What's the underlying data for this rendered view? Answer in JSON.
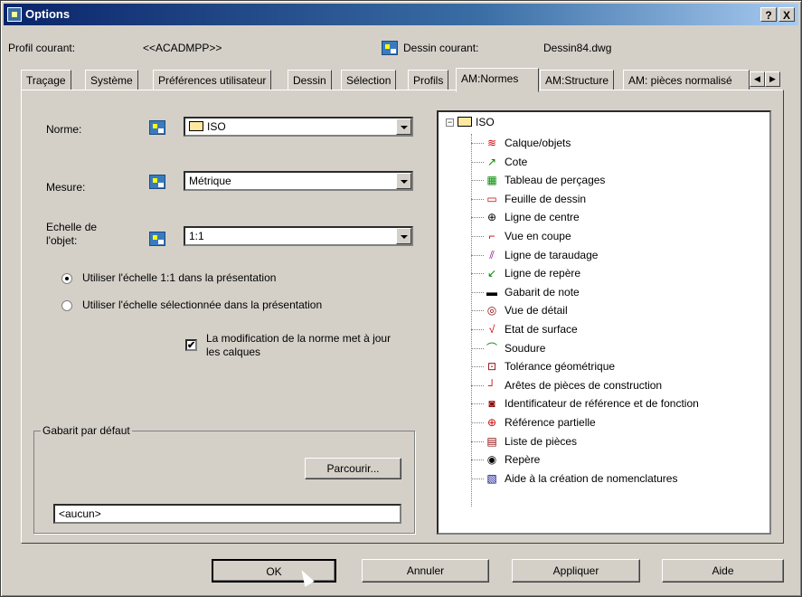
{
  "window": {
    "title": "Options",
    "help_btn": "?",
    "close_btn": "X"
  },
  "header": {
    "profile_label": "Profil courant:",
    "profile_value": "<<ACADMPP>>",
    "drawing_label": "Dessin courant:",
    "drawing_value": "Dessin84.dwg"
  },
  "tabs": [
    {
      "label": "Traçage"
    },
    {
      "label": "Système"
    },
    {
      "label": "Préférences utilisateur"
    },
    {
      "label": "Dessin"
    },
    {
      "label": "Sélection"
    },
    {
      "label": "Profils"
    },
    {
      "label": "AM:Normes"
    },
    {
      "label": "AM:Structure"
    },
    {
      "label": "AM: pièces normalisé"
    }
  ],
  "active_tab": "AM:Normes",
  "form": {
    "norme_label": "Norme:",
    "norme_value": "ISO",
    "mesure_label": "Mesure:",
    "mesure_value": "Métrique",
    "echelle_label_1": "Echelle de",
    "echelle_label_2": "l'objet:",
    "echelle_value": "1:1",
    "radio1": "Utiliser l'échelle 1:1 dans la présentation",
    "radio2": "Utiliser l'échelle sélectionnée dans la présentation",
    "checkbox_line1": "La modification de la norme met à jour",
    "checkbox_line2": "les calques",
    "checkbox_mark": "✔"
  },
  "template": {
    "group_title": "Gabarit par défaut",
    "browse_btn": "Parcourir...",
    "input_value": "<aucun>"
  },
  "tree": {
    "root": "ISO",
    "items": [
      {
        "label": "Calque/objets",
        "icon": "layers-icon"
      },
      {
        "label": "Cote",
        "icon": "dimension-icon"
      },
      {
        "label": "Tableau de perçages",
        "icon": "hole-table-icon"
      },
      {
        "label": "Feuille de dessin",
        "icon": "drawing-sheet-icon"
      },
      {
        "label": "Ligne de centre",
        "icon": "centerline-icon"
      },
      {
        "label": "Vue en coupe",
        "icon": "section-view-icon"
      },
      {
        "label": "Ligne de taraudage",
        "icon": "thread-line-icon"
      },
      {
        "label": "Ligne de repère",
        "icon": "leader-line-icon"
      },
      {
        "label": "Gabarit de note",
        "icon": "note-template-icon"
      },
      {
        "label": "Vue de détail",
        "icon": "detail-view-icon"
      },
      {
        "label": "Etat de surface",
        "icon": "surface-texture-icon"
      },
      {
        "label": "Soudure",
        "icon": "weld-icon"
      },
      {
        "label": "Tolérance géométrique",
        "icon": "geometric-tolerance-icon"
      },
      {
        "label": "Arêtes de pièces de construction",
        "icon": "edge-icon"
      },
      {
        "label": "Identificateur de référence et de fonction",
        "icon": "datum-identifier-icon"
      },
      {
        "label": "Référence partielle",
        "icon": "datum-target-icon"
      },
      {
        "label": "Liste de pièces",
        "icon": "parts-list-icon"
      },
      {
        "label": "Repère",
        "icon": "balloon-icon"
      },
      {
        "label": "Aide à la création de nomenclatures",
        "icon": "bom-icon"
      }
    ]
  },
  "buttons": {
    "ok": "OK",
    "cancel": "Annuler",
    "apply": "Appliquer",
    "help": "Aide"
  },
  "colors": {
    "titlebar": "#0a246a",
    "face": "#d4d0c8"
  }
}
